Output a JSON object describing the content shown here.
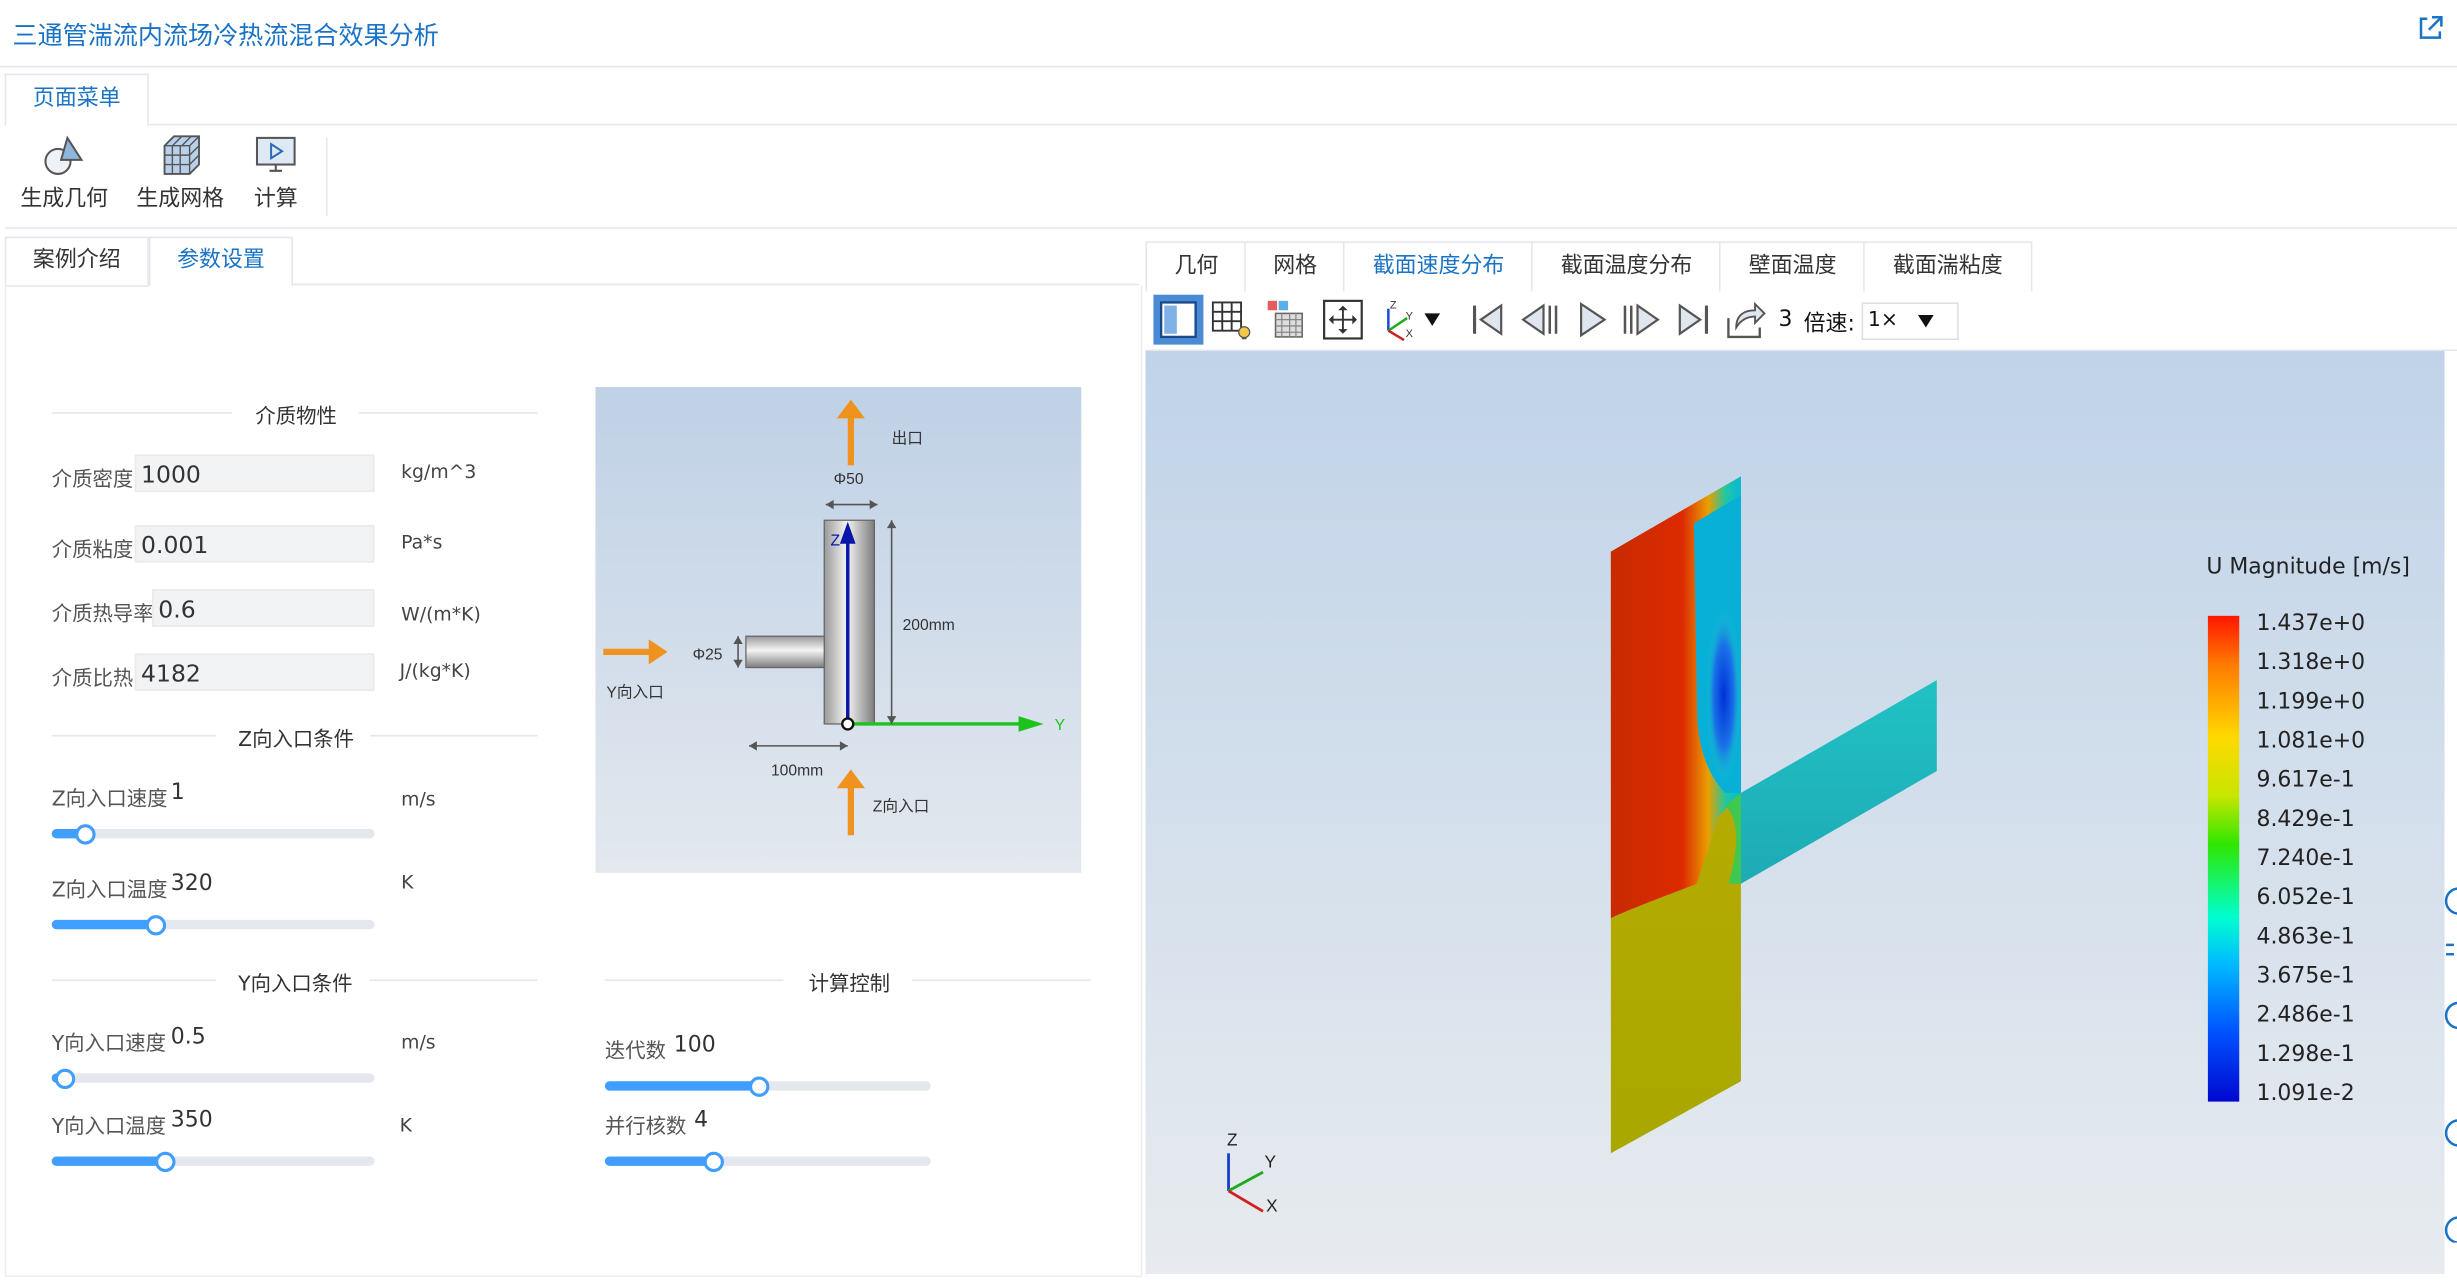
{
  "app": {
    "title": "三通管湍流内流场冷热流混合效果分析"
  },
  "menu": {
    "tab": "页面菜单"
  },
  "toolbar": {
    "items": [
      {
        "label": "生成几何",
        "icon": "geometry-icon"
      },
      {
        "label": "生成网格",
        "icon": "mesh-icon"
      },
      {
        "label": "计算",
        "icon": "compute-icon"
      }
    ]
  },
  "left_tabs": [
    "案例介绍",
    "参数设置"
  ],
  "left_tabs_active": 1,
  "medium": {
    "section": "介质物性",
    "density": {
      "label": "介质密度",
      "value": "1000",
      "unit": "kg/m^3"
    },
    "viscosity": {
      "label": "介质粘度",
      "value": "0.001",
      "unit": "Pa*s"
    },
    "conductivity": {
      "label": "介质热导率",
      "value": "0.6",
      "unit": "W/(m*K)"
    },
    "specific_heat": {
      "label": "介质比热",
      "value": "4182",
      "unit": "J/(kg*K)"
    }
  },
  "z_inlet": {
    "section": "Z向入口条件",
    "speed": {
      "label": "Z向入口速度",
      "value": "1",
      "unit": "m/s",
      "fraction": 0.1
    },
    "temp": {
      "label": "Z向入口温度",
      "value": "320",
      "unit": "K",
      "fraction": 0.32
    }
  },
  "y_inlet": {
    "section": "Y向入口条件",
    "speed": {
      "label": "Y向入口速度",
      "value": "0.5",
      "unit": "m/s",
      "fraction": 0.04
    },
    "temp": {
      "label": "Y向入口温度",
      "value": "350",
      "unit": "K",
      "fraction": 0.35
    }
  },
  "calc": {
    "section": "计算控制",
    "iterations": {
      "label": "迭代数",
      "value": "100",
      "fraction": 0.47
    },
    "cores": {
      "label": "并行核数",
      "value": "4",
      "fraction": 0.33
    }
  },
  "diagram": {
    "outlet": "出口",
    "phi50": "Φ50",
    "phi25": "Φ25",
    "len200": "200mm",
    "len100": "100mm",
    "y_inlet": "Y向入口",
    "z_inlet": "Z向入口",
    "axis_z": "Z",
    "axis_y": "Y"
  },
  "result_tabs": [
    "几何",
    "网格",
    "截面速度分布",
    "截面温度分布",
    "壁面温度",
    "截面湍粘度"
  ],
  "result_tabs_active": 2,
  "viewer": {
    "frame": "3",
    "speed_label": "倍速:",
    "speed_value": "1×"
  },
  "legend": {
    "title": "U Magnitude [m/s]",
    "ticks": [
      "1.437e+0",
      "1.318e+0",
      "1.199e+0",
      "1.081e+0",
      "9.617e-1",
      "8.429e-1",
      "7.240e-1",
      "6.052e-1",
      "4.863e-1",
      "3.675e-1",
      "2.486e-1",
      "1.298e-1",
      "1.091e-2"
    ]
  },
  "triad": {
    "z": "Z",
    "y": "Y",
    "x": "X"
  },
  "colors": {
    "accent": "#409eff",
    "title_blue": "#1a73c5",
    "arrow_orange": "#f0921e"
  }
}
